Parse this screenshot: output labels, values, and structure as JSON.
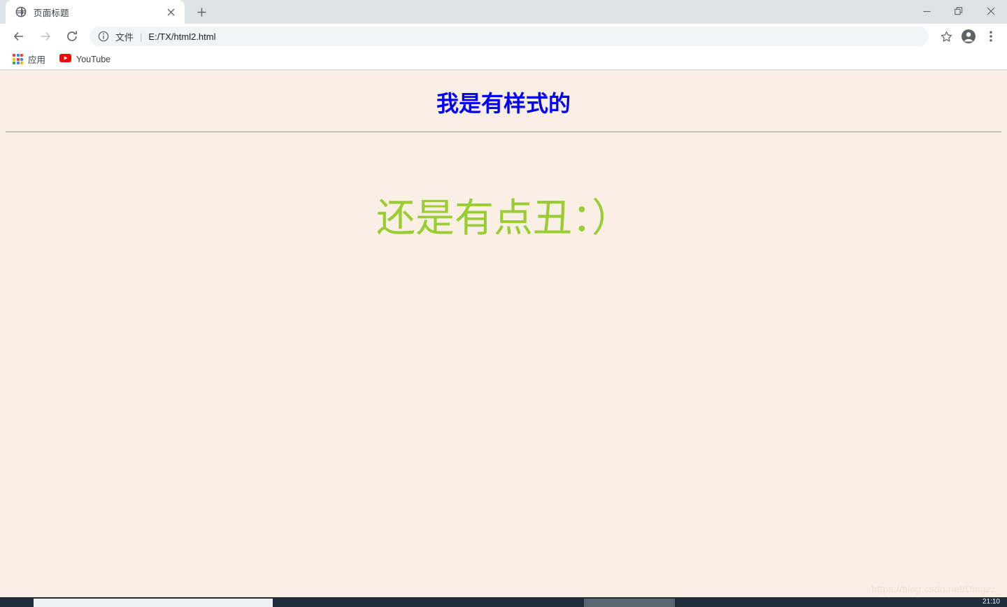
{
  "browser": {
    "tab": {
      "favicon": "globe-icon",
      "title": "页面标题",
      "close_label": "×"
    },
    "new_tab_label": "+",
    "window_controls": {
      "minimize": "minimize-icon",
      "maximize": "restore-icon",
      "close": "close-icon"
    },
    "toolbar": {
      "back": "back-arrow-icon",
      "forward": "forward-arrow-icon",
      "reload": "reload-icon",
      "omnibox": {
        "info_icon": "info-circle-icon",
        "scheme_label": "文件",
        "separator": "|",
        "url": "E:/TX/html2.html"
      },
      "bookmark_star": "star-icon",
      "profile": "profile-avatar-icon",
      "menu": "three-dot-menu-icon"
    },
    "bookmarks_bar": [
      {
        "icon": "apps-grid-icon",
        "label": "应用"
      },
      {
        "icon": "youtube-icon",
        "label": "YouTube"
      }
    ]
  },
  "page": {
    "heading": "我是有样式的",
    "heading_color": "#0000ff",
    "paragraph": "还是有点丑：）",
    "paragraph_color": "#9acd32",
    "background_color": "#faefe4",
    "rule_color": "#9e9e9e",
    "watermark": "https://blog.csdn.net/Dingzz_"
  },
  "taskbar": {
    "background_color": "#1f2d3a",
    "clock": "21:10"
  }
}
